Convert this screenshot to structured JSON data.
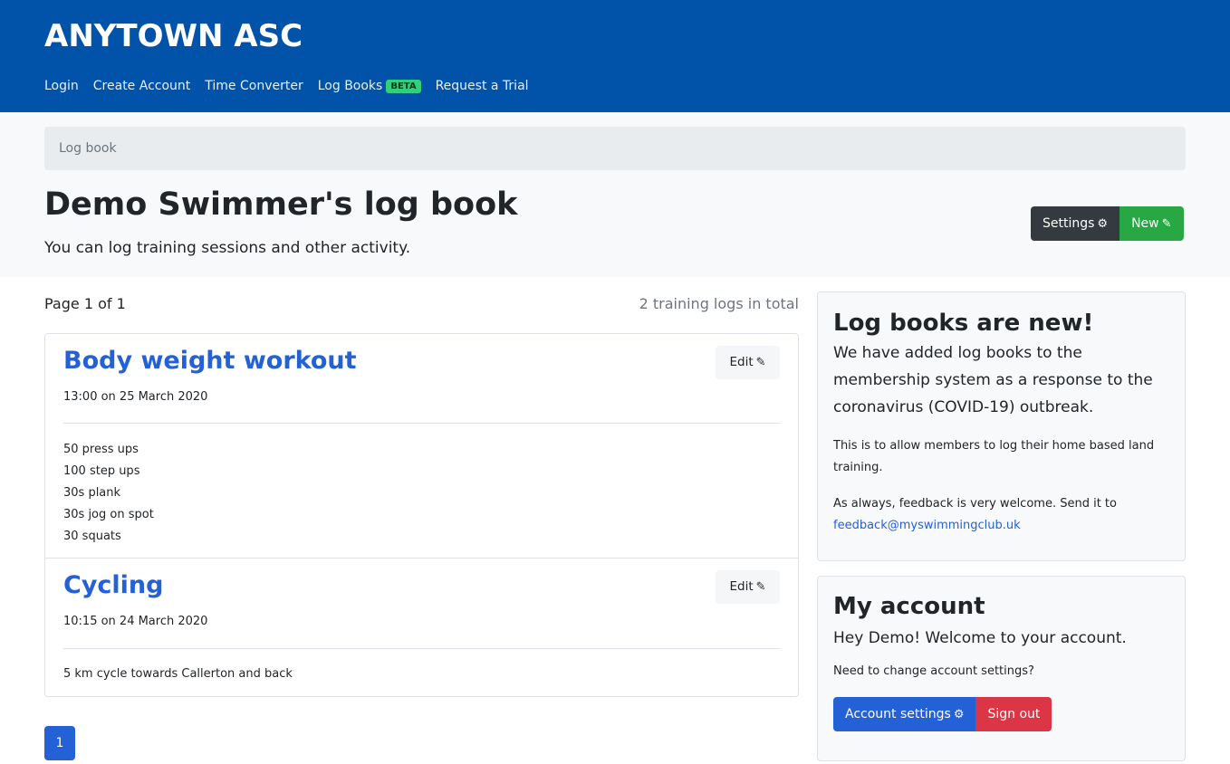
{
  "header": {
    "brand": "ANYTOWN ASC",
    "nav": [
      {
        "label": "Login"
      },
      {
        "label": "Create Account"
      },
      {
        "label": "Time Converter"
      },
      {
        "label": "Log Books",
        "badge": "BETA"
      },
      {
        "label": "Request a Trial"
      }
    ]
  },
  "breadcrumb": {
    "label": "Log book"
  },
  "page": {
    "title": "Demo Swimmer's log book",
    "lead": "You can log training sessions and other activity.",
    "settings_label": "Settings",
    "new_label": "New"
  },
  "list": {
    "page_info": "Page 1 of 1",
    "total_info": "2 training logs in total",
    "edit_label": "Edit",
    "logs": [
      {
        "title": "Body weight workout",
        "date": "13:00 on 25 March 2020",
        "lines": [
          "50 press ups",
          "100 step ups",
          "30s plank",
          "30s jog on spot",
          "30 squats"
        ]
      },
      {
        "title": "Cycling",
        "date": "10:15 on 24 March 2020",
        "lines": [
          "5 km cycle towards Callerton and back"
        ]
      }
    ],
    "current_page": "1"
  },
  "news_card": {
    "title": "Log books are new!",
    "lead": "We have added log books to the membership system as a response to the coronavirus (COVID-19) outbreak.",
    "p1": "This is to allow members to log their home based land training.",
    "p2": "As always, feedback is very welcome. Send it to",
    "email": "feedback@myswimmingclub.uk"
  },
  "account_card": {
    "title": "My account",
    "lead": "Hey Demo! Welcome to your account.",
    "prompt": "Need to change account settings?",
    "settings_label": "Account settings",
    "signout_label": "Sign out"
  },
  "icons": {
    "settings": "gear-icon",
    "new": "edit-icon",
    "edit": "edit-icon"
  },
  "colors": {
    "header": "#0053a8",
    "link": "#2461d6",
    "success": "#28a745",
    "danger": "#dc3545",
    "dark": "#343a40",
    "badge": "#30d07c"
  }
}
